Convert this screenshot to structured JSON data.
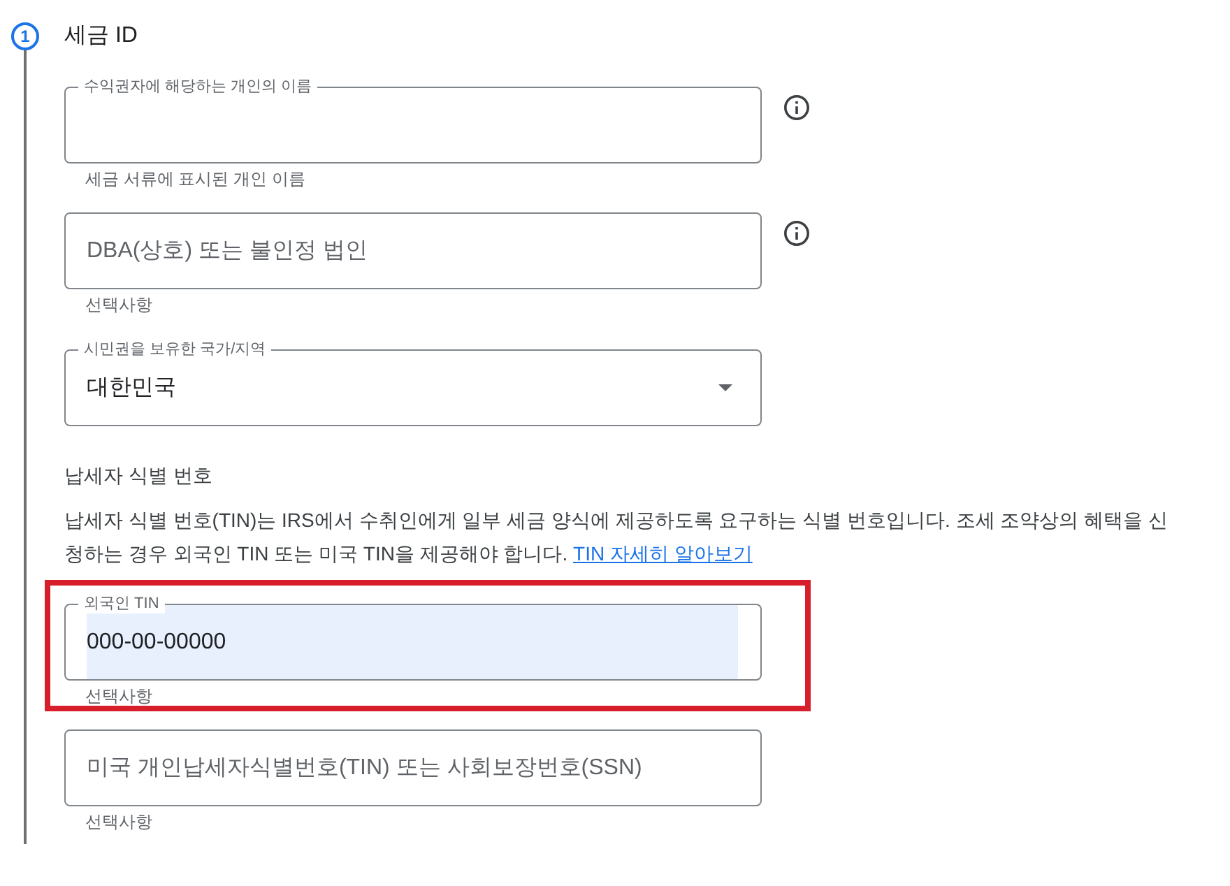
{
  "step": {
    "number": "1",
    "title": "세금 ID"
  },
  "fields": [
    {
      "kind": "text",
      "label": "수익권자에 해당하는 개인의 이름",
      "helper": "세금 서류에 표시된 개인 이름",
      "info": true
    },
    {
      "kind": "text",
      "placeholder": "DBA(상호) 또는 불인정 법인",
      "helper": "선택사항",
      "info": true
    },
    {
      "kind": "select",
      "label": "시민권을 보유한 국가/지역",
      "value": "대한민국",
      "info": false
    }
  ],
  "tin_section": {
    "heading": "납세자 식별 번호",
    "description": "납세자 식별 번호(TIN)는 IRS에서 수취인에게 일부 세금 양식에 제공하도록 요구하는 식별 번호입니다. 조세 조약상의 혜택을 신청하는 경우 외국인 TIN 또는 미국 TIN을 제공해야 합니다.",
    "link": "TIN 자세히 알아보기",
    "fields": [
      {
        "kind": "text",
        "label": "외국인 TIN",
        "value": "000-00-00000",
        "helper": "선택사항",
        "info": false,
        "autofilled": true,
        "highlighted": true
      },
      {
        "kind": "text",
        "placeholder": "미국 개인납세자식별번호(TIN) 또는 사회보장번호(SSN)",
        "helper": "선택사항",
        "info": false,
        "autofilled": false,
        "highlighted": false
      }
    ]
  }
}
